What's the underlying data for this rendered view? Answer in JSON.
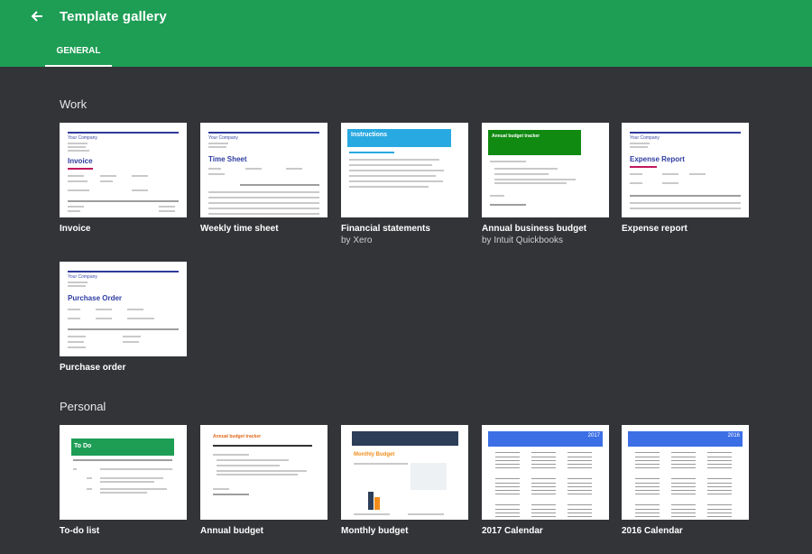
{
  "header": {
    "title": "Template gallery",
    "back_icon": "arrow-back-icon",
    "tabs": [
      {
        "label": "GENERAL",
        "selected": true
      }
    ]
  },
  "colors": {
    "header": "#1e9e55",
    "background": "#333438"
  },
  "sections": [
    {
      "title": "Work",
      "templates": [
        {
          "name": "Invoice",
          "sub": ""
        },
        {
          "name": "Weekly time sheet",
          "sub": ""
        },
        {
          "name": "Financial statements",
          "sub": "by Xero"
        },
        {
          "name": "Annual business budget",
          "sub": "by Intuit Quickbooks"
        },
        {
          "name": "Expense report",
          "sub": ""
        },
        {
          "name": "Purchase order",
          "sub": ""
        }
      ]
    },
    {
      "title": "Personal",
      "templates": [
        {
          "name": "To-do list",
          "sub": ""
        },
        {
          "name": "Annual budget",
          "sub": ""
        },
        {
          "name": "Monthly budget",
          "sub": ""
        },
        {
          "name": "2017 Calendar",
          "sub": ""
        },
        {
          "name": "2016 Calendar",
          "sub": ""
        }
      ]
    }
  ],
  "thumbnails": {
    "invoice": {
      "company": "Your Company",
      "heading": "Invoice"
    },
    "timesheet": {
      "company": "Your Company",
      "heading": "Time Sheet"
    },
    "financial": {
      "heading": "Instructions"
    },
    "business_budget": {
      "heading": "Annual budget tracker"
    },
    "expense": {
      "company": "Your Company",
      "heading": "Expense Report"
    },
    "purchase": {
      "company": "Your Company",
      "heading": "Purchase Order"
    },
    "todo": {
      "heading": "To Do"
    },
    "annual_budget": {
      "heading": "Annual budget tracker"
    },
    "monthly": {
      "heading": "Monthly Budget"
    },
    "cal2017": {
      "year": "2017"
    },
    "cal2016": {
      "year": "2016"
    }
  }
}
